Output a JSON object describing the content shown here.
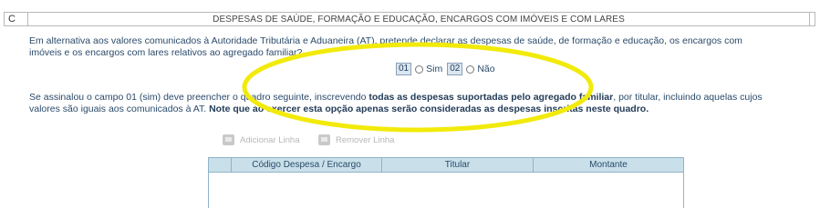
{
  "section": {
    "letter": "C",
    "title": "DESPESAS DE SAÚDE, FORMAÇÃO E EDUCAÇÃO, ENCARGOS COM IMÓVEIS E COM LARES"
  },
  "intro": {
    "text": "Em alternativa aos valores comunicados à Autoridade Tributária e Aduaneira (AT), pretende declarar as despesas de saúde, de formação e educação, os encargos com imóveis e os encargos com lares relativos ao agregado familiar?"
  },
  "options": {
    "yes_code": "01",
    "yes_label": "Sim",
    "no_code": "02",
    "no_label": "Não"
  },
  "instructions": {
    "part1": "Se assinalou o campo 01 (sim) deve preencher o quadro seguinte, inscrevendo ",
    "bold1": "todas as despesas suportadas pelo agregado familiar",
    "part2": ", por titular, incluindo aquelas cujos valores são iguais aos comunicados à AT. ",
    "bold2": "Note que ao exercer esta opção apenas serão consideradas as despesas inscritas neste quadro."
  },
  "toolbar": {
    "add_label": "Adicionar Linha",
    "remove_label": "Remover Linha"
  },
  "table": {
    "columns": [
      "",
      "Código Despesa / Encargo",
      "Titular",
      "Montante"
    ]
  },
  "colors": {
    "highlight": "#f2ea0a",
    "table_header": "#c9e0ea"
  }
}
